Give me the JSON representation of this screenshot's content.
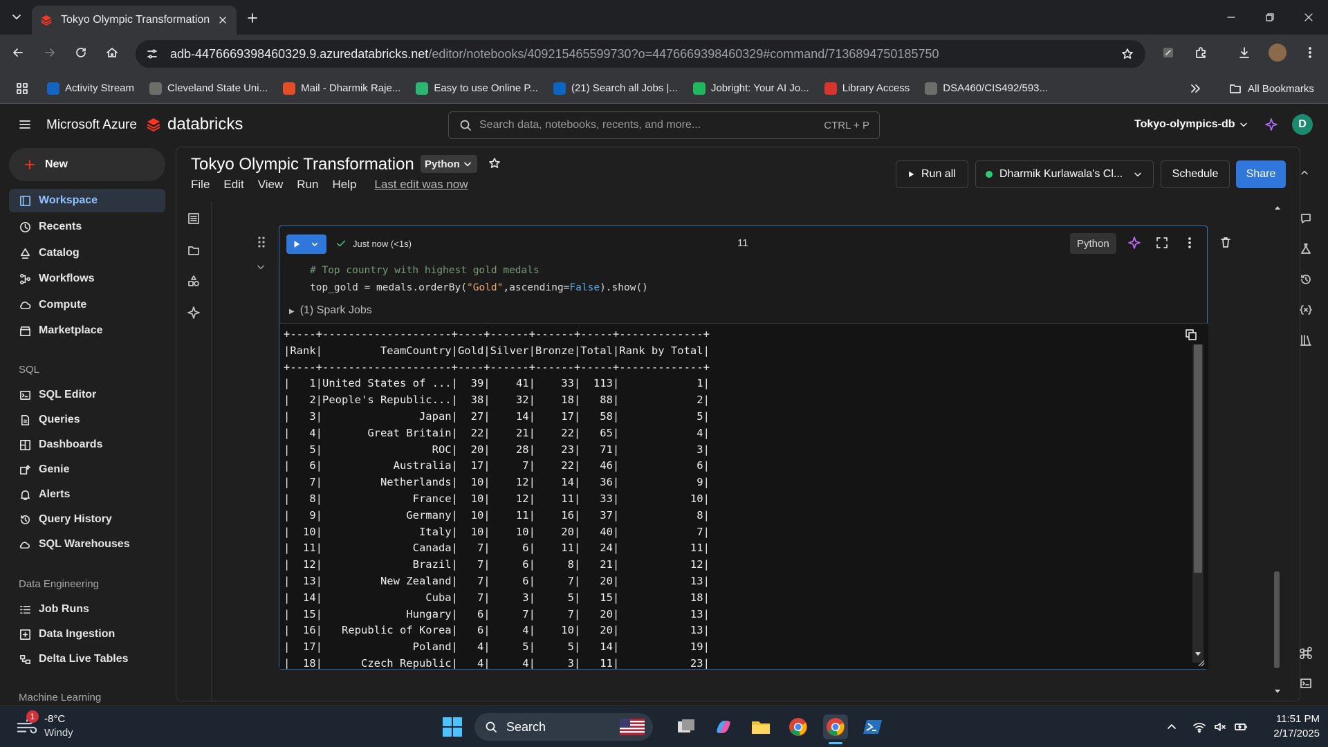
{
  "browser": {
    "tab_title": "Tokyo Olympic Transformation",
    "url_host": "adb-4476669398460329.9.azuredatabricks.net",
    "url_path": "/editor/notebooks/409215465599730?o=4476669398460329#command/7136894750185750",
    "bookmarks": [
      {
        "label": "Activity Stream",
        "color": "#1565c0",
        "icon": "a-letter-icon"
      },
      {
        "label": "Cleveland State Uni...",
        "color": "#6d6d6d",
        "icon": "globe-icon"
      },
      {
        "label": "Mail - Dharmik Raje...",
        "color": "#e44d26",
        "icon": "windows-grid-icon"
      },
      {
        "label": "Easy to use Online P...",
        "color": "#2bb673",
        "icon": "s-letter-icon"
      },
      {
        "label": "(21) Search all Jobs |...",
        "color": "#0a66c2",
        "icon": "linkedin-icon"
      },
      {
        "label": "Jobright: Your AI Jo...",
        "color": "#1fb85f",
        "icon": "jobright-icon"
      },
      {
        "label": "Library Access",
        "color": "#d6342c",
        "icon": "o-icon"
      },
      {
        "label": "DSA460/CIS492/593...",
        "color": "#6d6d6d",
        "icon": "globe-icon"
      }
    ],
    "all_bookmarks": "All Bookmarks"
  },
  "header": {
    "brand_azure": "Microsoft Azure",
    "brand_db": "databricks",
    "search_placeholder": "Search data, notebooks, recents, and more...",
    "search_shortcut": "CTRL + P",
    "workspace": "Tokyo-olympics-db",
    "avatar": "D"
  },
  "sidebar": {
    "new": "New",
    "items": [
      {
        "label": "Workspace"
      },
      {
        "label": "Recents"
      },
      {
        "label": "Catalog"
      },
      {
        "label": "Workflows"
      },
      {
        "label": "Compute"
      },
      {
        "label": "Marketplace"
      }
    ],
    "sql_section": "SQL",
    "sql_items": [
      {
        "label": "SQL Editor"
      },
      {
        "label": "Queries"
      },
      {
        "label": "Dashboards"
      },
      {
        "label": "Genie"
      },
      {
        "label": "Alerts"
      },
      {
        "label": "Query History"
      },
      {
        "label": "SQL Warehouses"
      }
    ],
    "de_section": "Data Engineering",
    "de_items": [
      {
        "label": "Job Runs"
      },
      {
        "label": "Data Ingestion"
      },
      {
        "label": "Delta Live Tables"
      }
    ],
    "ml_section": "Machine Learning"
  },
  "notebook": {
    "title": "Tokyo Olympic Transformation",
    "language": "Python",
    "menus": [
      "File",
      "Edit",
      "View",
      "Run",
      "Help"
    ],
    "last_edit": "Last edit was now",
    "run_all": "Run all",
    "cluster": "Dharmik Kurlawala's Cl...",
    "schedule": "Schedule",
    "share": "Share"
  },
  "cell": {
    "status": "Just now (<1s)",
    "number": "11",
    "lang": "Python",
    "code_comment": "# Top country with highest gold medals",
    "code_line": "top_gold = medals.orderBy(\"Gold\",ascending=False).show()",
    "spark_jobs": "(1) Spark Jobs",
    "output_lines": [
      "+----+--------------------+----+------+------+-----+-------------+",
      "|Rank|         TeamCountry|Gold|Silver|Bronze|Total|Rank by Total|",
      "+----+--------------------+----+------+------+-----+-------------+",
      "|   1|United States of ...|  39|    41|    33|  113|            1|",
      "|   2|People's Republic...|  38|    32|    18|   88|            2|",
      "|   3|               Japan|  27|    14|    17|   58|            5|",
      "|   4|       Great Britain|  22|    21|    22|   65|            4|",
      "|   5|                 ROC|  20|    28|    23|   71|            3|",
      "|   6|           Australia|  17|     7|    22|   46|            6|",
      "|   7|         Netherlands|  10|    12|    14|   36|            9|",
      "|   8|              France|  10|    12|    11|   33|           10|",
      "|   9|             Germany|  10|    11|    16|   37|            8|",
      "|  10|               Italy|  10|    10|    20|   40|            7|",
      "|  11|              Canada|   7|     6|    11|   24|           11|",
      "|  12|              Brazil|   7|     6|     8|   21|           12|",
      "|  13|         New Zealand|   7|     6|     7|   20|           13|",
      "|  14|                Cuba|   7|     3|     5|   15|           18|",
      "|  15|             Hungary|   6|     7|     7|   20|           13|",
      "|  16|   Republic of Korea|   6|     4|    10|   20|           13|",
      "|  17|              Poland|   4|     5|     5|   14|           19|",
      "|  18|      Czech Republic|   4|     4|     3|   11|           23|"
    ]
  },
  "taskbar": {
    "weather_temp": "-8°C",
    "weather_desc": "Windy",
    "weather_badge": "1",
    "search": "Search",
    "time": "11:51 PM",
    "date": "2/17/2025"
  }
}
